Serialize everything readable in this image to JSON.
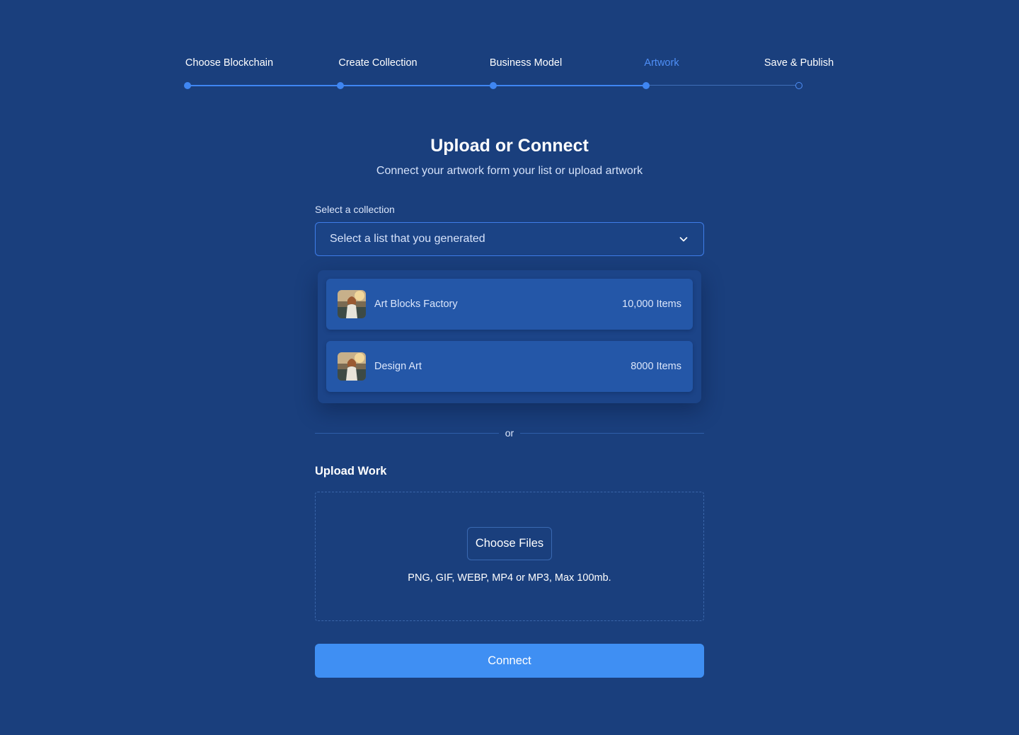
{
  "stepper": {
    "steps": [
      {
        "label": "Choose Blockchain",
        "state": "completed"
      },
      {
        "label": "Create Collection",
        "state": "completed"
      },
      {
        "label": "Business Model",
        "state": "completed"
      },
      {
        "label": "Artwork",
        "state": "active"
      },
      {
        "label": "Save & Publish",
        "state": "pending"
      }
    ]
  },
  "header": {
    "title": "Upload or Connect",
    "subtitle": "Connect your artwork form your list or upload artwork"
  },
  "collection": {
    "label": "Select a collection",
    "placeholder": "Select a list that you generated",
    "options": [
      {
        "name": "Art Blocks Factory",
        "count": "10,000 Items",
        "icon": "artwork-thumbnail"
      },
      {
        "name": "Design Art",
        "count": "8000 Items",
        "icon": "artwork-thumbnail"
      }
    ]
  },
  "divider": {
    "text": "or"
  },
  "upload": {
    "title": "Upload Work",
    "choose_label": "Choose Files",
    "formats": "PNG, GIF, WEBP, MP4 or MP3, Max 100mb."
  },
  "actions": {
    "connect_label": "Connect"
  },
  "colors": {
    "background": "#1a3f7d",
    "accent": "#3f8ff3",
    "active_step": "#4f8ff7",
    "option_bg": "#2457a8"
  }
}
